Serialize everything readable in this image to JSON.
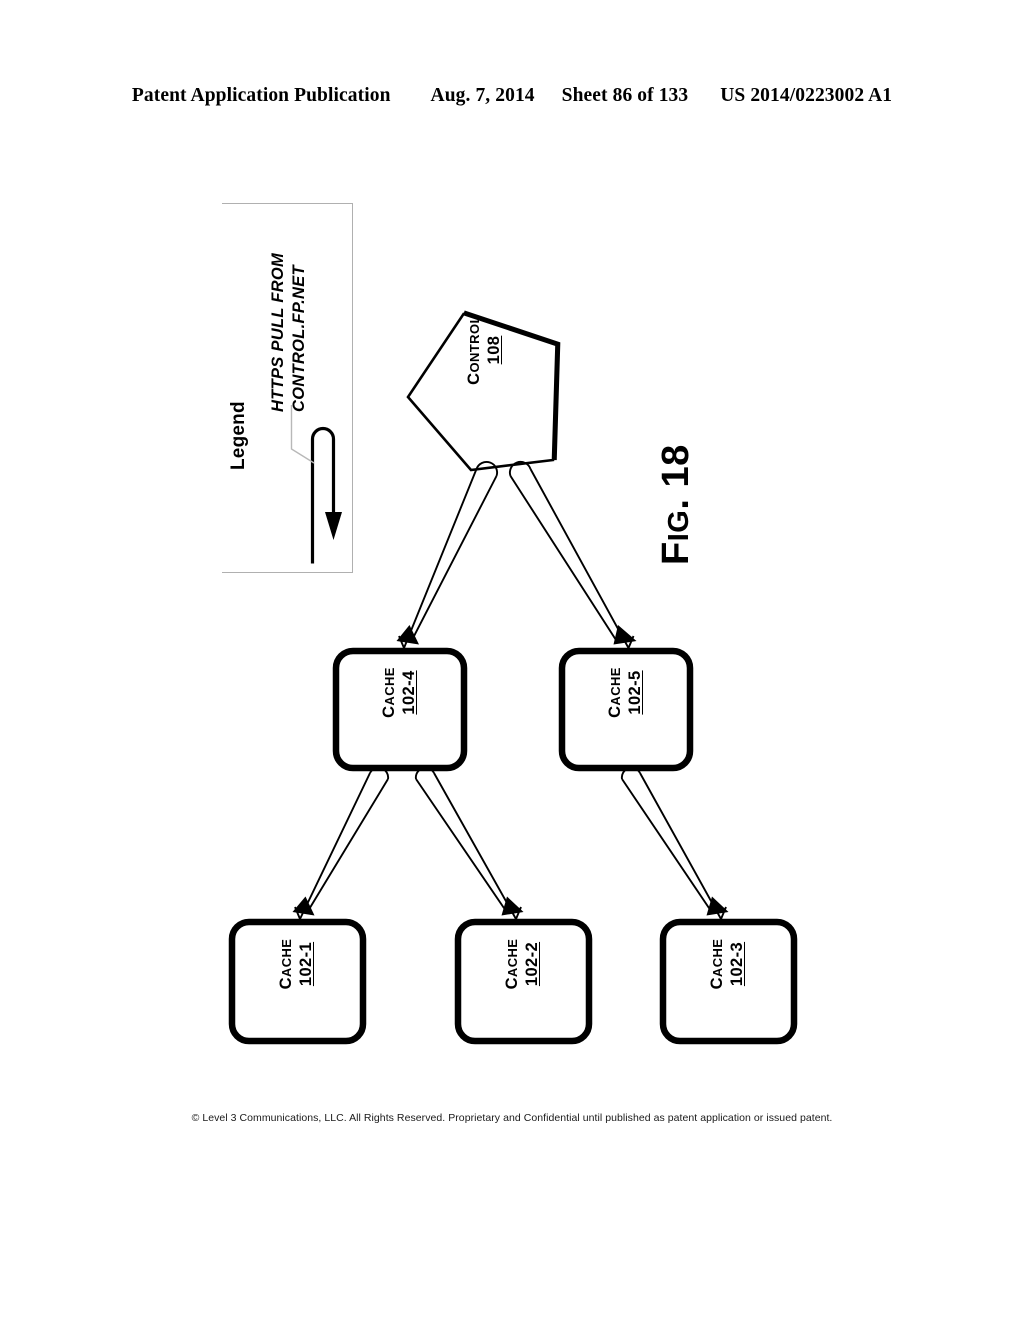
{
  "header": {
    "publication": "Patent Application Publication",
    "date": "Aug. 7, 2014",
    "sheet": "Sheet 86 of 133",
    "pub_number": "US 2014/0223002 A1"
  },
  "figure": {
    "fig_label_prefix": "F",
    "fig_label_rest": "IG",
    "fig_label_number": ". 18",
    "legend": {
      "title": "Legend",
      "arrow_label_line1": "HTTPS PULL FROM",
      "arrow_label_line2": "CONTROL.FP.NET",
      "sample_arrow_icon": "hollow-down-arrow-icon"
    },
    "nodes": {
      "control": {
        "title_first": "C",
        "title_rest": "ONTROL",
        "ref": "108",
        "shape": "pentagon"
      },
      "cache_102_4": {
        "title_first": "C",
        "title_rest": "ACHE",
        "ref": "102-4",
        "shape": "rounded-rect"
      },
      "cache_102_5": {
        "title_first": "C",
        "title_rest": "ACHE",
        "ref": "102-5",
        "shape": "rounded-rect"
      },
      "cache_102_1": {
        "title_first": "C",
        "title_rest": "ACHE",
        "ref": "102-1",
        "shape": "rounded-rect"
      },
      "cache_102_2": {
        "title_first": "C",
        "title_rest": "ACHE",
        "ref": "102-2",
        "shape": "rounded-rect"
      },
      "cache_102_3": {
        "title_first": "C",
        "title_rest": "ACHE",
        "ref": "102-3",
        "shape": "rounded-rect"
      }
    },
    "connections": [
      {
        "from": "control",
        "to": "cache_102_4",
        "style": "hollow-arrow"
      },
      {
        "from": "control",
        "to": "cache_102_5",
        "style": "hollow-arrow"
      },
      {
        "from": "cache_102_4",
        "to": "cache_102_1",
        "style": "hollow-arrow"
      },
      {
        "from": "cache_102_4",
        "to": "cache_102_2",
        "style": "hollow-arrow"
      },
      {
        "from": "cache_102_5",
        "to": "cache_102_3",
        "style": "hollow-arrow"
      }
    ],
    "colors": {
      "ink": "#000000",
      "legend_border": "#b0b0b0",
      "leader_line": "#b8b8b8",
      "paper": "#ffffff"
    }
  },
  "footer": {
    "copyright": "© Level 3 Communications, LLC.  All Rights Reserved.  Proprietary and Confidential until published as patent application or issued patent."
  }
}
